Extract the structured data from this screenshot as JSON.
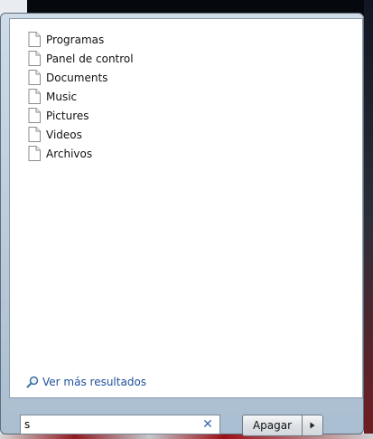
{
  "results": [
    {
      "label": "Programas",
      "icon": "document-icon"
    },
    {
      "label": "Panel de control",
      "icon": "document-icon"
    },
    {
      "label": "Documents",
      "icon": "document-icon"
    },
    {
      "label": "Music",
      "icon": "document-icon"
    },
    {
      "label": "Pictures",
      "icon": "document-icon"
    },
    {
      "label": "Videos",
      "icon": "document-icon"
    },
    {
      "label": "Archivos",
      "icon": "document-icon"
    }
  ],
  "more_results": {
    "label": "Ver más resultados",
    "icon": "magnifier-icon"
  },
  "search": {
    "value": "s",
    "clear_icon": "clear-x-icon"
  },
  "shutdown": {
    "label": "Apagar",
    "arrow_icon": "triangle-right-icon"
  },
  "colors": {
    "link": "#1f4f9b",
    "clear_x": "#3a6ab0",
    "pane": "#ffffff"
  }
}
